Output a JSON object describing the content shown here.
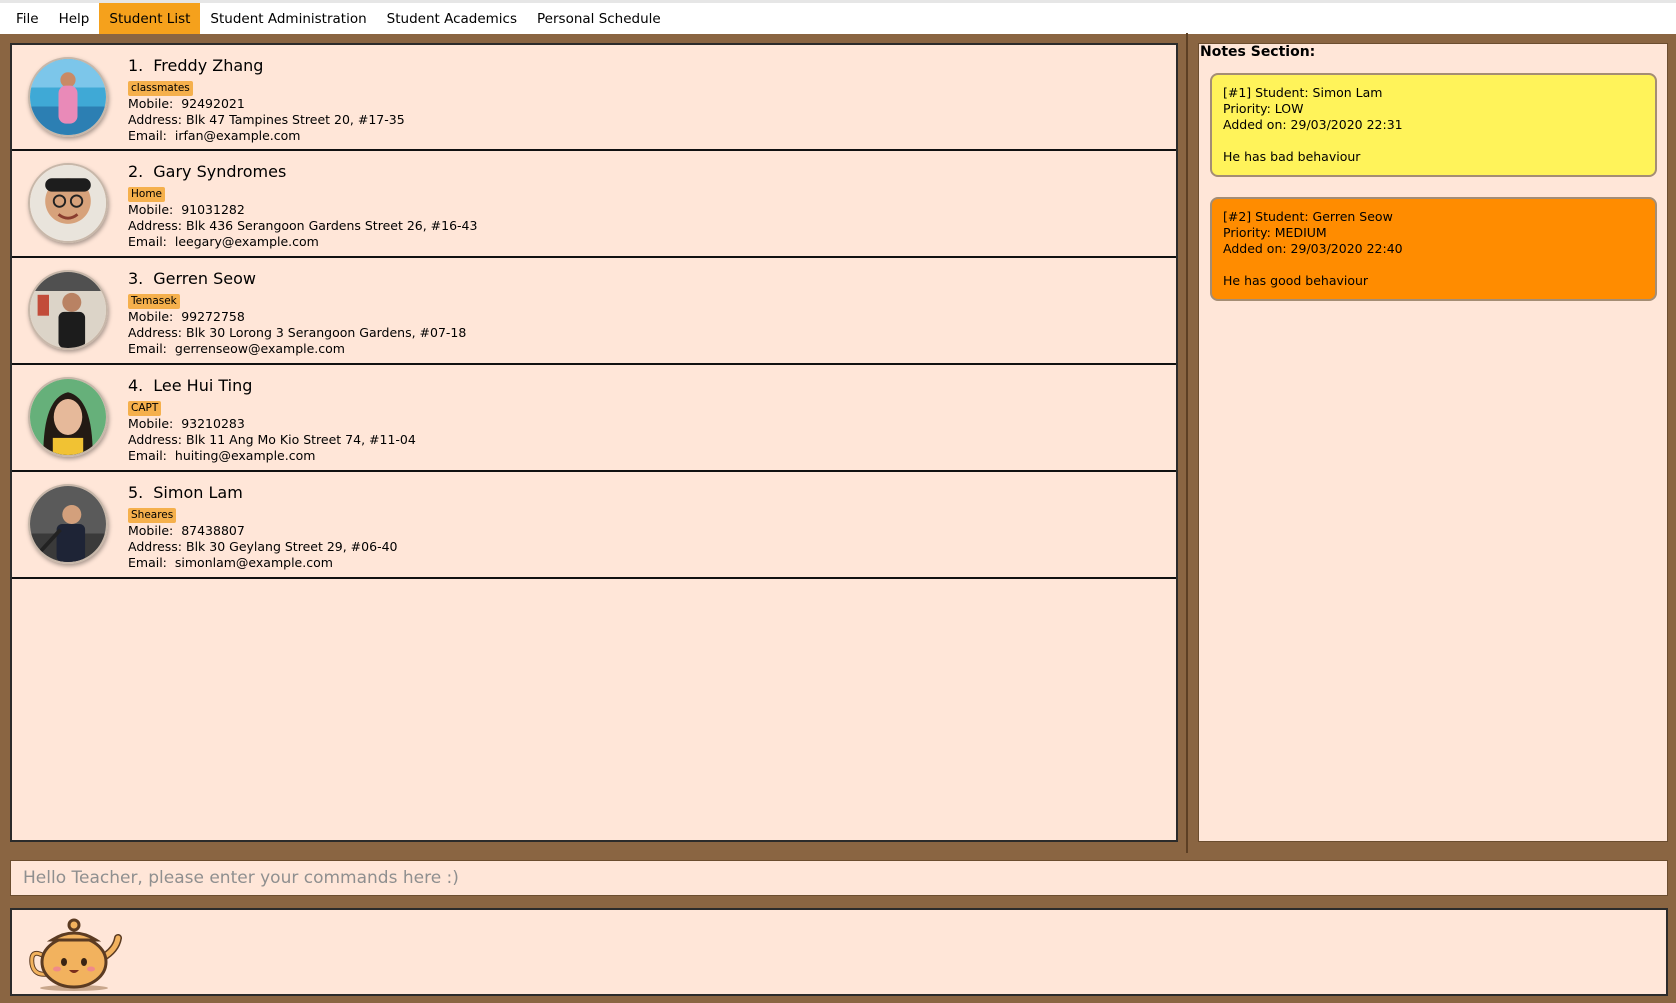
{
  "menu": [
    "File",
    "Help",
    "Student List",
    "Student Administration",
    "Student Academics",
    "Personal Schedule"
  ],
  "active_menu_index": 2,
  "labels": {
    "mobile": "Mobile:",
    "address": "Address:",
    "email": "Email:"
  },
  "students": [
    {
      "index": "1.",
      "name": "Freddy Zhang",
      "tag": "classmates",
      "mobile": "92492021",
      "address": "Blk 47 Tampines Street 20, #17-35",
      "email": "irfan@example.com"
    },
    {
      "index": "2.",
      "name": "Gary Syndromes",
      "tag": "Home",
      "mobile": "91031282",
      "address": "Blk 436 Serangoon Gardens Street 26, #16-43",
      "email": "leegary@example.com"
    },
    {
      "index": "3.",
      "name": "Gerren Seow",
      "tag": "Temasek",
      "mobile": "99272758",
      "address": "Blk 30 Lorong 3 Serangoon Gardens, #07-18",
      "email": "gerrenseow@example.com"
    },
    {
      "index": "4.",
      "name": "Lee Hui Ting",
      "tag": "CAPT",
      "mobile": "93210283",
      "address": "Blk 11 Ang Mo Kio Street 74, #11-04",
      "email": "huiting@example.com"
    },
    {
      "index": "5.",
      "name": "Simon Lam",
      "tag": "Sheares",
      "mobile": "87438807",
      "address": "Blk 30 Geylang Street 29, #06-40",
      "email": "simonlam@example.com"
    }
  ],
  "notes_title": "Notes Section:",
  "notes": [
    {
      "header": "[#1] Student: Simon Lam",
      "priority": "Priority: LOW",
      "added": "Added on: 29/03/2020 22:31",
      "content": "He has bad behaviour",
      "color": "#fff35a"
    },
    {
      "header": "[#2] Student: Gerren Seow",
      "priority": "Priority: MEDIUM",
      "added": "Added on: 29/03/2020 22:40",
      "content": "He has good behaviour",
      "color": "#ff8c00"
    }
  ],
  "command_placeholder": "Hello Teacher, please enter your commands here :)",
  "colors": {
    "accent": "#f5a11c",
    "panel": "#ffe6d8",
    "frame": "#8a6542",
    "tag": "#f5b04c"
  },
  "icons": {
    "result_mascot": "teapot-icon"
  }
}
